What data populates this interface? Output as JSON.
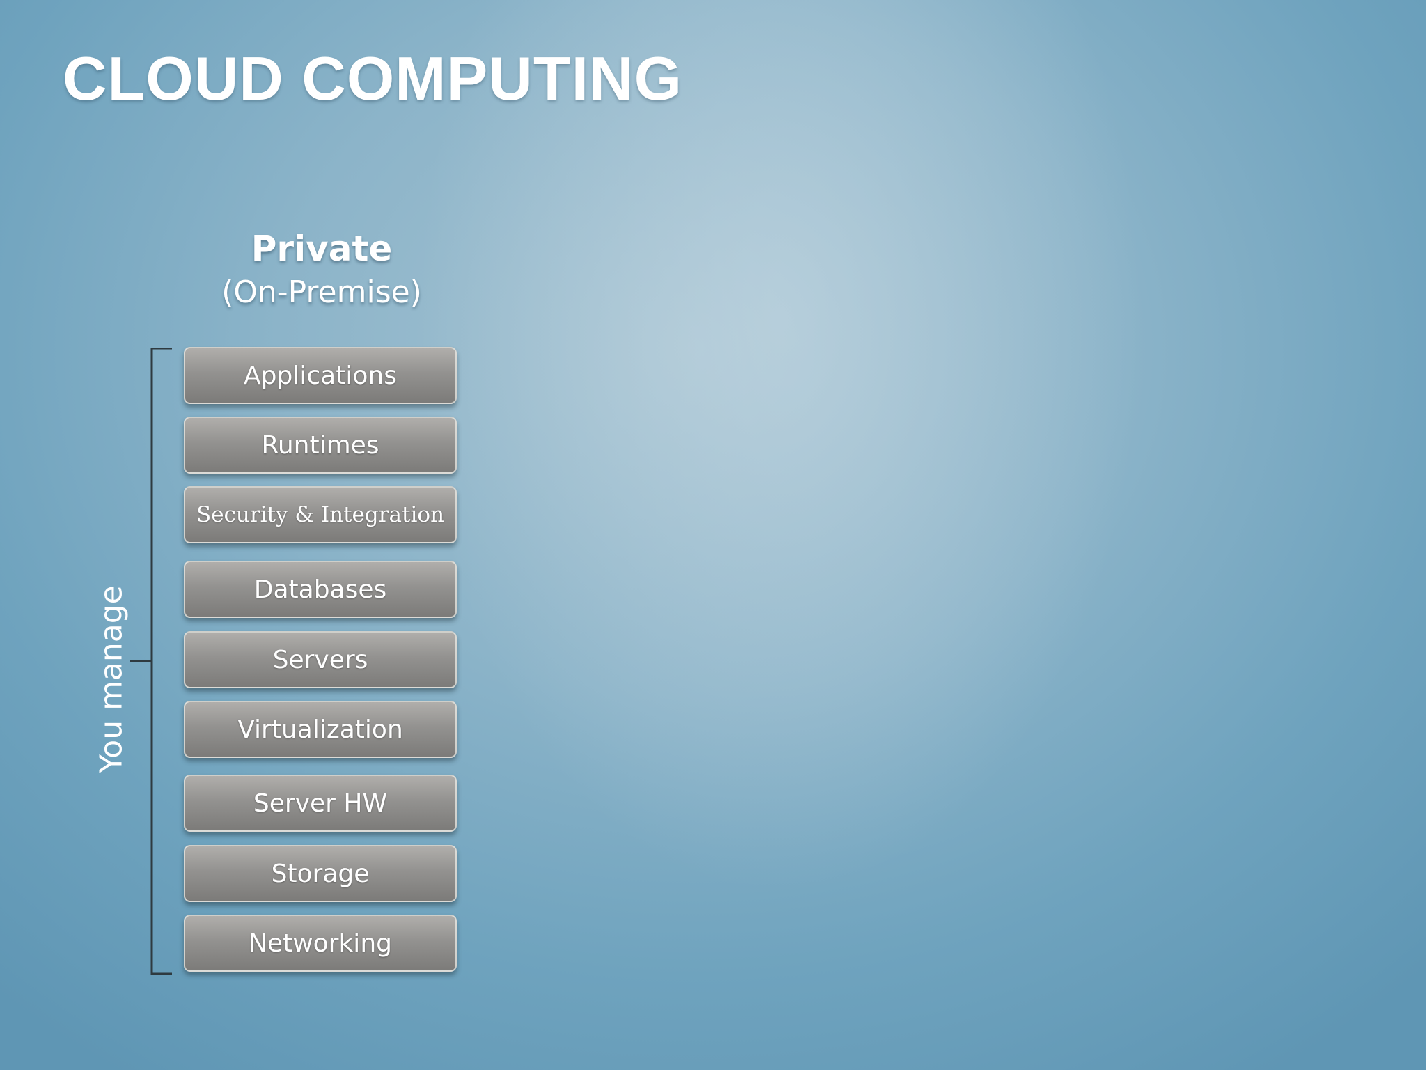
{
  "slide": {
    "title": "CLOUD COMPUTING"
  },
  "column": {
    "title": "Private",
    "subtitle": "(On-Premise)",
    "side_label": "You manage",
    "layers": [
      "Applications",
      "Runtimes",
      "Security & Integration",
      "Databases",
      "Servers",
      "Virtualization",
      "Server HW",
      "Storage",
      "Networking"
    ]
  }
}
